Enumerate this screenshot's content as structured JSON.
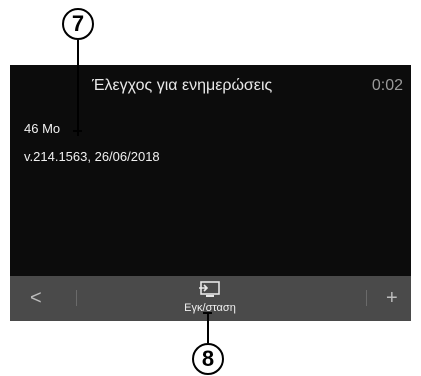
{
  "screen": {
    "title": "Έλεγχος για ενημερώσεις",
    "clock": "0:02",
    "size": "46 Mo",
    "version": "v.214.1563, 26/06/2018"
  },
  "bottom_bar": {
    "back_icon": "chevron-left-icon",
    "back_glyph": "<",
    "install_icon": "install-icon",
    "install_label": "Εγκ/σταση",
    "plus_icon": "plus-icon",
    "plus_glyph": "+"
  },
  "callouts": {
    "seven": "7",
    "eight": "8"
  },
  "colors": {
    "screen_bg": "#0c0c0c",
    "bar_bg": "#4a4a4a",
    "text": "#f0f0f0",
    "clock": "#9a9a9a"
  }
}
